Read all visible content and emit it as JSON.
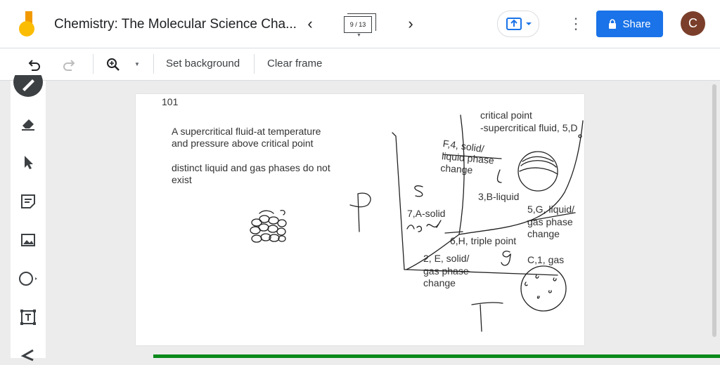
{
  "header": {
    "title": "Chemistry: The Molecular Science Cha...",
    "frame_counter": "9 / 13",
    "share_label": "Share",
    "avatar_initial": "C"
  },
  "toolbar": {
    "set_background": "Set background",
    "clear_frame": "Clear frame"
  },
  "sidebar": {
    "tools": [
      "pen-icon",
      "eraser-icon",
      "select-icon",
      "sticky-note-icon",
      "image-icon",
      "circle-icon",
      "text-box-icon",
      "laser-icon"
    ]
  },
  "canvas": {
    "page_number": "101",
    "note_line1": "A supercritical fluid-at temperature",
    "note_line2": "and pressure above critical point",
    "note_line3": "distinct liquid and gas phases do not",
    "note_line4": "exist",
    "label_critical_1": "critical point",
    "label_critical_2": "-supercritical fluid, 5,D",
    "label_f4_1": "F,4, solid/",
    "label_f4_2": "liquid phase",
    "label_f4_3": "change",
    "label_liquid": "3,B-liquid",
    "label_solid": "7,A-solid",
    "label_g5_1": "5,G, liquid/",
    "label_g5_2": "gas phase",
    "label_g5_3": "change",
    "label_triple": "6,H, triple point",
    "label_e2_1": "2, E, solid/",
    "label_e2_2": "gas phase",
    "label_e2_3": "change",
    "label_gas": "C,1, gas"
  },
  "colors": {
    "accent": "#1a73e8",
    "avatar": "#7a3e2a",
    "progress": "#0b8a1c"
  }
}
